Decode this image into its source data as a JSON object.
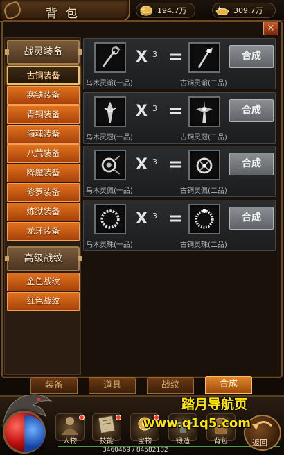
{
  "window": {
    "title": "背包"
  },
  "currency": {
    "coin1": "194.7万",
    "coin2": "309.7万"
  },
  "close_label": "×",
  "sidebar": {
    "section1": "战灵装备",
    "items1": [
      "古铜装备",
      "寒铁装备",
      "青铜装备",
      "海魂装备",
      "八荒装备",
      "降魔装备",
      "修罗装备",
      "炼狱装备",
      "龙牙装备"
    ],
    "active_index": 0,
    "section2": "高级战纹",
    "items2": [
      "金色战纹",
      "红色战纹"
    ]
  },
  "recipes": [
    {
      "input_name": "乌木灵谕(一品)",
      "count": "3",
      "output_name": "古铜灵谕(二品)",
      "button": "合成",
      "icon": "wand-icon"
    },
    {
      "input_name": "乌木灵冠(一品)",
      "count": "3",
      "output_name": "古铜灵冠(二品)",
      "button": "合成",
      "icon": "crown-icon"
    },
    {
      "input_name": "乌木灵佩(一品)",
      "count": "3",
      "output_name": "古铜灵佩(二品)",
      "button": "合成",
      "icon": "pendant-icon"
    },
    {
      "input_name": "乌木灵珠(一品)",
      "count": "3",
      "output_name": "古铜灵珠(二品)",
      "button": "合成",
      "icon": "bead-bracelet-icon"
    }
  ],
  "symbols": {
    "times": "X",
    "equals": "="
  },
  "tabs": [
    "装备",
    "道具",
    "战纹",
    "合成"
  ],
  "active_tab": 3,
  "bottom_menu": [
    "人物",
    "技能",
    "宝物",
    "锻造",
    "背包"
  ],
  "exp_text": "3460469 / 84582182",
  "back_label": "返回",
  "watermark": {
    "line1": "踏月导航页",
    "line2": "www.q1q5.com"
  },
  "colors": {
    "accent_orange": "#d8681a",
    "button_gray": "#7a7d81",
    "gold_text": "#f1dcae"
  }
}
